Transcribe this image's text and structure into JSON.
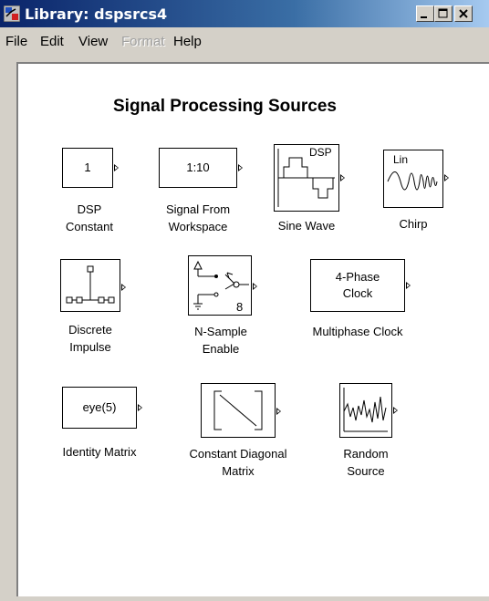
{
  "window": {
    "title": "Library: dspsrcs4"
  },
  "menu": {
    "file": "File",
    "edit": "Edit",
    "view": "View",
    "format": "Format",
    "help": "Help"
  },
  "canvas": {
    "title": "Signal Processing Sources"
  },
  "blocks": {
    "dsp_constant": {
      "content": "1",
      "label_line1": "DSP",
      "label_line2": "Constant"
    },
    "signal_from_workspace": {
      "content": "1:10",
      "label_line1": "Signal From",
      "label_line2": "Workspace"
    },
    "sine_wave": {
      "icon_text": "DSP",
      "label": "Sine Wave"
    },
    "chirp": {
      "icon_text": "Lin",
      "label": "Chirp"
    },
    "discrete_impulse": {
      "label_line1": "Discrete",
      "label_line2": "Impulse"
    },
    "n_sample_enable": {
      "icon_text": "8",
      "label_line1": "N-Sample",
      "label_line2": "Enable"
    },
    "multiphase_clock": {
      "content_line1": "4-Phase",
      "content_line2": "Clock",
      "label": "Multiphase Clock"
    },
    "identity_matrix": {
      "content": "eye(5)",
      "label": "Identity Matrix"
    },
    "constant_diagonal_matrix": {
      "label_line1": "Constant Diagonal",
      "label_line2": "Matrix"
    },
    "random_source": {
      "label_line1": "Random",
      "label_line2": "Source"
    }
  },
  "colors": {
    "titlebar_start": "#0a246a",
    "titlebar_end": "#a6caf0",
    "chrome": "#d4d0c8",
    "canvas": "#ffffff"
  }
}
